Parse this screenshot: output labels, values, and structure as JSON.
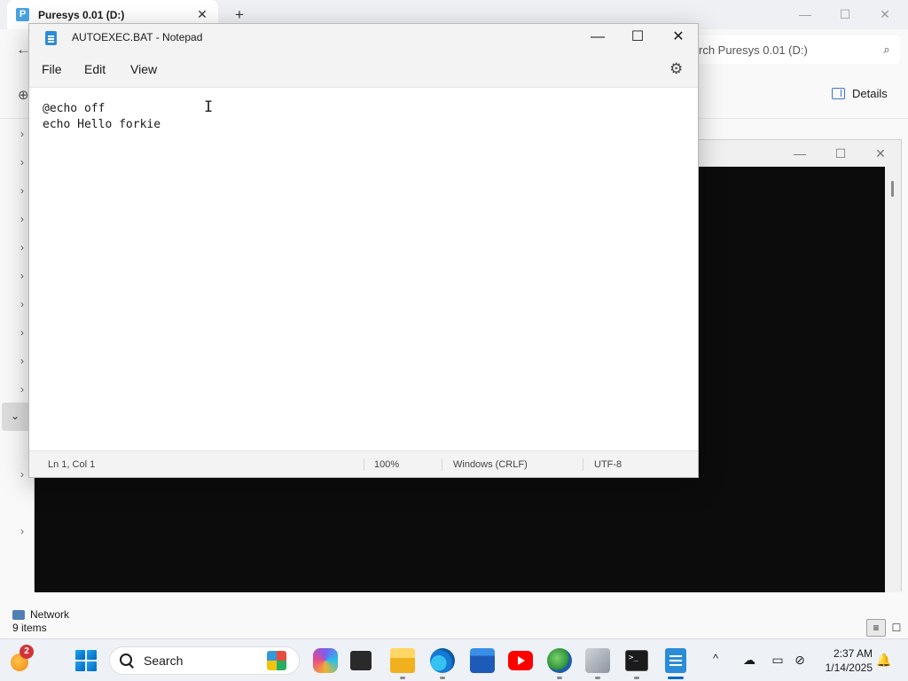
{
  "explorer": {
    "tab_icon": "P",
    "tab_title": "Puresys 0.01 (D:)",
    "tab_close": "✕",
    "new_tab": "+",
    "search_placeholder": "rch Puresys 0.01 (D:)",
    "details_label": "Details",
    "network_label": "Network",
    "status_items": "9 items"
  },
  "notepad": {
    "title": "AUTOEXEC.BAT - Notepad",
    "menu": {
      "file": "File",
      "edit": "Edit",
      "view": "View"
    },
    "lines": [
      "@echo off",
      "echo Hello forkie"
    ],
    "status": {
      "position": "Ln 1, Col 1",
      "zoom": "100%",
      "line_ending": "Windows (CRLF)",
      "encoding": "UTF-8"
    }
  },
  "taskbar": {
    "weather_badge": "2",
    "search_label": "Search",
    "time": "2:37 AM",
    "date": "1/14/2025"
  },
  "icons": {
    "min": "—",
    "max": "☐",
    "close": "✕",
    "gear": "⚙",
    "chevron_right": "›",
    "chevron_down": "⌄",
    "chevron_up": "^",
    "back_arrow": "←",
    "search": "⌕",
    "new_item": "⊕",
    "caret": "I"
  },
  "colors": {
    "accent": "#0067c0",
    "console_bg": "#0c0c0c",
    "notification_badge": "#d13438"
  }
}
